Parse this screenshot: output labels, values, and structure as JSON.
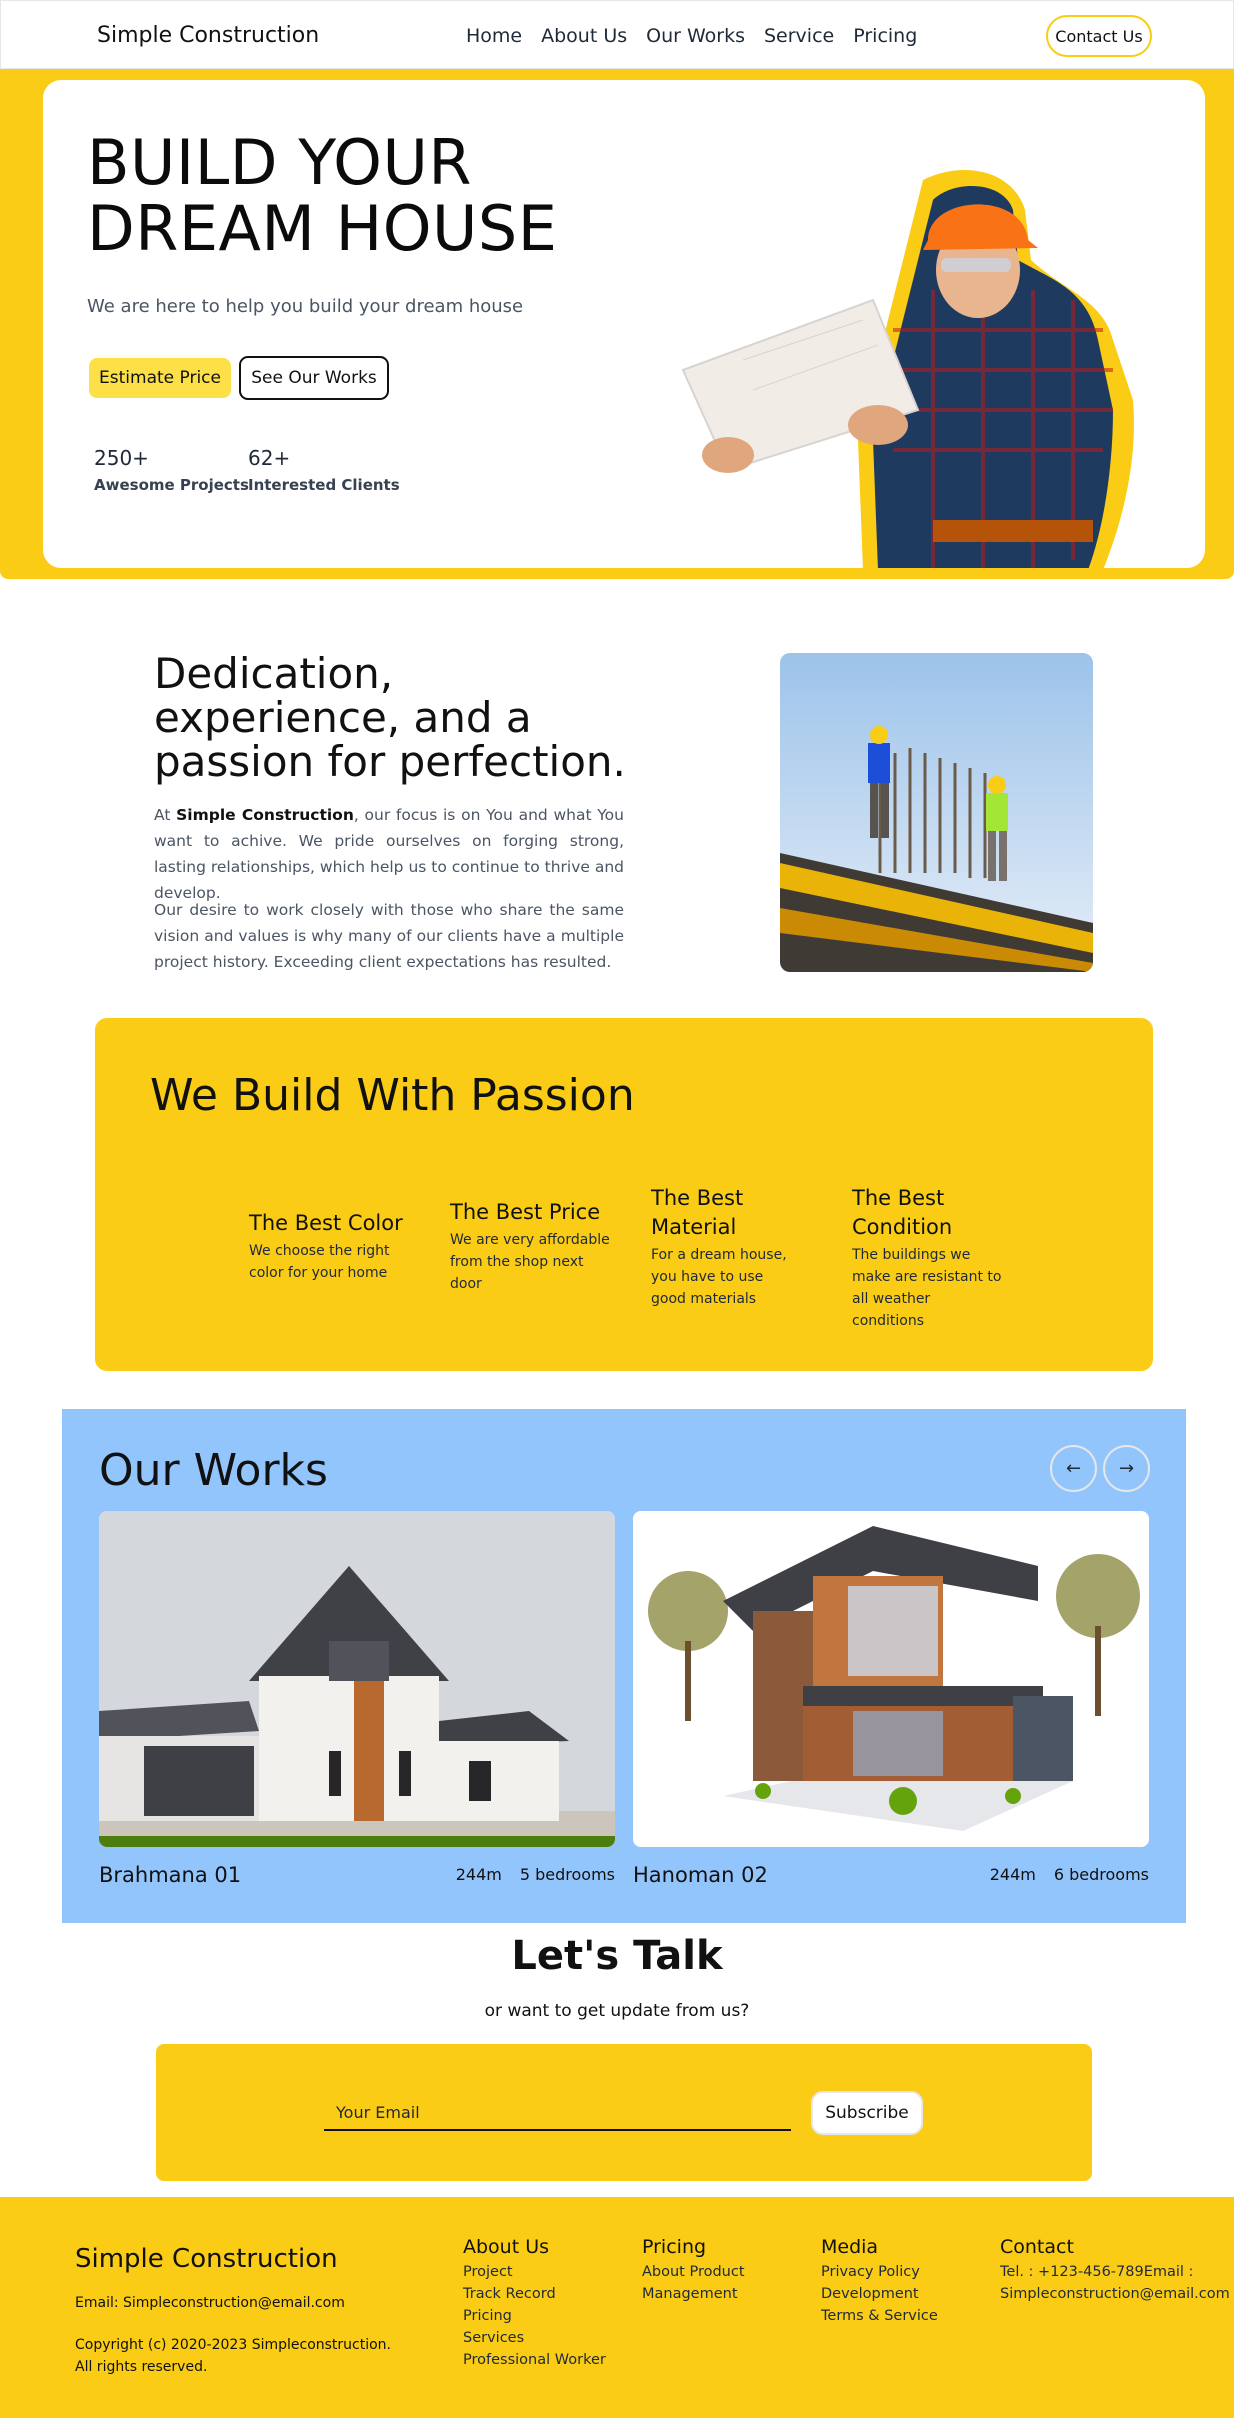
{
  "nav": {
    "brand": "Simple Construction",
    "links": [
      "Home",
      "About Us",
      "Our Works",
      "Service",
      "Pricing"
    ],
    "contact": "Contact Us"
  },
  "hero": {
    "title": "BUILD YOUR DREAM HOUSE",
    "subtitle": "We are here to help you build your dream house",
    "primary": "Estimate Price",
    "secondary": "See Our Works",
    "stats": [
      {
        "value": "250+",
        "label": "Awesome Projects"
      },
      {
        "value": "62+",
        "label": "Interested Clients"
      }
    ]
  },
  "about": {
    "title": "Dedication, experience, and a passion for perfection.",
    "p1_prefix": "At ",
    "p1_brand": "Simple Construction",
    "p1_rest": ", our focus is on You and what You want to achive. We pride ourselves on forging strong, lasting relationships, which help us to continue to thrive and develop.",
    "p2": "Our desire to work closely with those who share the same vision and values is why many of our clients have a multiple project history. Exceeding client expectations has resulted."
  },
  "passion": {
    "title": "We Build With Passion",
    "features": [
      {
        "title": "The Best Color",
        "text": "We choose the right color for your home"
      },
      {
        "title": "The Best Price",
        "text": "We are very affordable from the shop next door"
      },
      {
        "title": "The Best Material",
        "text": "For a dream house, you have to use good materials"
      },
      {
        "title": "The Best Condition",
        "text": "The buildings we make are resistant to all weather conditions"
      }
    ]
  },
  "works": {
    "title": "Our Works",
    "prev": "←",
    "next": "→",
    "items": [
      {
        "name": "Brahmana 01",
        "size": "244m",
        "rooms": "5 bedrooms"
      },
      {
        "name": "Hanoman 02",
        "size": "244m",
        "rooms": "6 bedrooms"
      }
    ]
  },
  "talk": {
    "title": "Let's Talk",
    "subtitle": "or want to get update from us?",
    "placeholder": "Your Email",
    "button": "Subscribe"
  },
  "footer": {
    "brand": "Simple Construction",
    "email": "Email: Simpleconstruction@email.com",
    "copyright": "Copyright (c) 2020-2023 Simpleconstruction. All rights reserved.",
    "about": {
      "title": "About Us",
      "links": [
        "Project",
        "Track Record",
        "Pricing",
        "Services",
        "Professional Worker"
      ]
    },
    "pricing": {
      "title": "Pricing",
      "links": [
        "About Product",
        "Management"
      ]
    },
    "media": {
      "title": "Media",
      "links": [
        "Privacy Policy",
        "Development",
        "Terms & Service"
      ]
    },
    "contact": {
      "title": "Contact",
      "text": "Tel. : +123-456-789Email : Simpleconstruction@email.com"
    }
  },
  "colors": {
    "accent": "#facc15",
    "works_bg": "#93c5fd"
  }
}
